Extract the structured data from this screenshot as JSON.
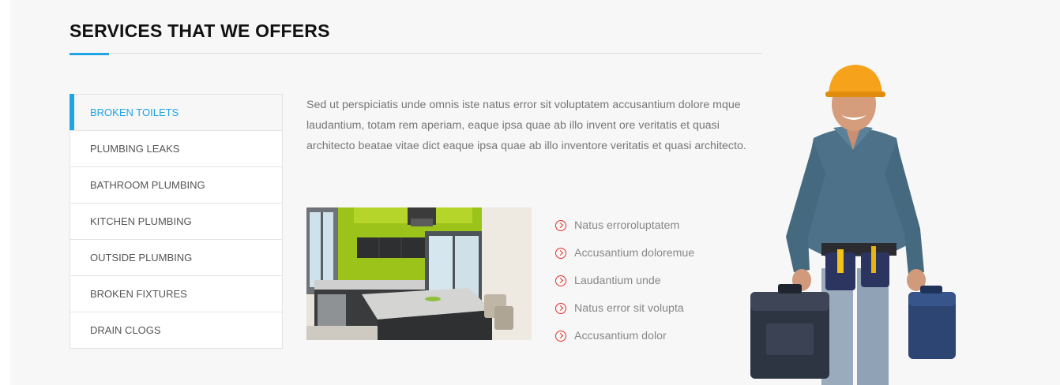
{
  "section": {
    "title": "SERVICES THAT WE OFFERS",
    "accent_color": "#1ea5e6"
  },
  "menu": {
    "items": [
      {
        "label": "BROKEN TOILETS",
        "active": true
      },
      {
        "label": "PLUMBING LEAKS",
        "active": false
      },
      {
        "label": "BATHROOM PLUMBING",
        "active": false
      },
      {
        "label": "KITCHEN PLUMBING",
        "active": false
      },
      {
        "label": "OUTSIDE PLUMBING",
        "active": false
      },
      {
        "label": "BROKEN FIXTURES",
        "active": false
      },
      {
        "label": "DRAIN CLOGS",
        "active": false
      }
    ]
  },
  "content": {
    "description": "Sed ut perspiciatis unde omnis iste natus error sit voluptatem accusantium dolore mque laudantium, totam rem aperiam, eaque ipsa quae ab illo invent ore veritatis et quasi architecto beatae vitae dict eaque ipsa quae ab illo inventore veritatis et quasi architecto.",
    "image_icon": "kitchen-photo",
    "bullet_icon": "circle-arrow-right-icon",
    "bullet_color": "#e2312c",
    "features": [
      "Natus erroroluptatem",
      "Accusantium doloremue",
      "Laudantium unde",
      "Natus error sit volupta",
      "Accusantium dolor"
    ]
  },
  "hero_image": "plumber-with-toolboxes"
}
